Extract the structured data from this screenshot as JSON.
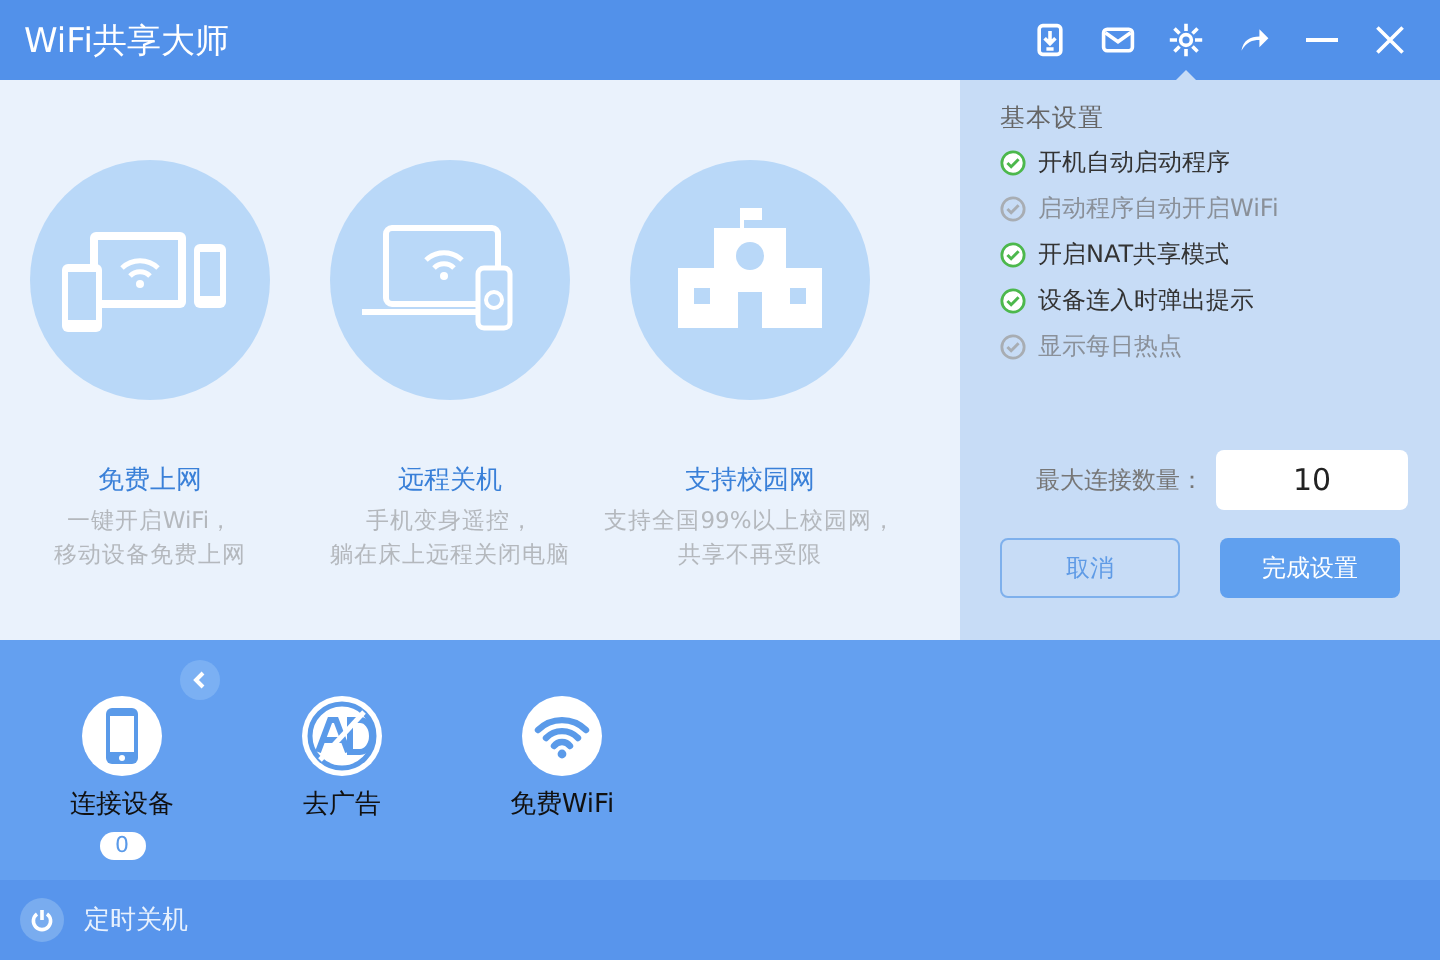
{
  "window": {
    "title": "WiFi共享大师"
  },
  "toolbar": [
    {
      "kind": "download",
      "selected": false
    },
    {
      "kind": "mail",
      "selected": false
    },
    {
      "kind": "settings",
      "selected": true
    },
    {
      "kind": "share",
      "selected": false
    },
    {
      "kind": "minimize",
      "selected": false
    },
    {
      "kind": "close",
      "selected": false
    }
  ],
  "features": [
    {
      "kind": "devices",
      "title": "免费上网",
      "lines": [
        "一键开启WiFi，",
        "移动设备免费上网"
      ]
    },
    {
      "kind": "laptop",
      "title": "远程关机",
      "lines": [
        "手机变身遥控，",
        "躺在床上远程关闭电脑"
      ]
    },
    {
      "kind": "school",
      "title": "支持校园网",
      "lines": [
        "支持全国99%以上校园网，",
        "共享不再受限"
      ]
    }
  ],
  "settings": {
    "heading": "基本设置",
    "options": [
      {
        "label": "开机自动启动程序",
        "checked": true
      },
      {
        "label": "启动程序自动开启WiFi",
        "checked": false
      },
      {
        "label": "开启NAT共享模式",
        "checked": true
      },
      {
        "label": "设备连入时弹出提示",
        "checked": true
      },
      {
        "label": "显示每日热点",
        "checked": false
      }
    ],
    "max_connections": {
      "label": "最大连接数量：",
      "value": "10"
    },
    "buttons": [
      {
        "label": "取消",
        "kind": "secondary"
      },
      {
        "label": "完成设置",
        "kind": "primary"
      }
    ]
  },
  "tools": [
    {
      "kind": "phone",
      "label": "连接设备",
      "badge": "0"
    },
    {
      "kind": "no-ads",
      "label": "去广告"
    },
    {
      "kind": "wifi",
      "label": "免费WiFi"
    }
  ],
  "footer": {
    "label": "定时关机"
  }
}
